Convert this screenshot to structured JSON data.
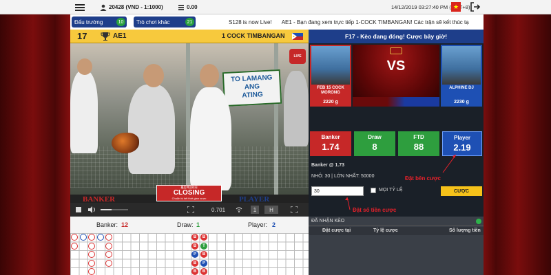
{
  "topbar": {
    "account": "20428 (VND - 1:1000)",
    "balance": "0.00",
    "datetime": "14/12/2019 03:27:40 PM (GMT+8)"
  },
  "tabs": [
    {
      "label": "Đấu trường",
      "count": "10"
    },
    {
      "label": "Trò chơi khác",
      "count": "21"
    }
  ],
  "ticker": [
    "S128 is now Live!",
    "AE1 - Bạn đang xem trực tiếp 1-COCK TIMBANGAN! Các trận sẽ kết thúc tạ"
  ],
  "fight": {
    "number": "17",
    "arena": "AE1",
    "title": "1 COCK TIMBANGAN",
    "status": "F17 - Kèo đang đóng! Cược bây giờ!"
  },
  "video": {
    "sign_text": "TO LAMANG ANG\nATING",
    "banker_label": "BANKER",
    "player_label": "PLAYER",
    "closing_top": "最后押注时间",
    "closing": "CLOSING",
    "closing_sub": "Chuẩn bị hết thời gian cược",
    "time": "0.701",
    "quality": "H"
  },
  "cocks": {
    "left": {
      "name": "FEB 15 COCK MORONG",
      "weight": "2220 g"
    },
    "right": {
      "name": "ALPHINE DJ",
      "weight": "2230 g"
    },
    "vs": "VS"
  },
  "odds": [
    {
      "label": "Banker",
      "value": "1.74",
      "color": "#c62828"
    },
    {
      "label": "Draw",
      "value": "8",
      "color": "#2e9e3e"
    },
    {
      "label": "FTD",
      "value": "88",
      "color": "#2e9e3e"
    },
    {
      "label": "Player",
      "value": "2.19",
      "color": "#1e50b4"
    }
  ],
  "bet": {
    "selection": "Banker @ 1.73",
    "limits": "NHỎ: 30 | LỚN NHẤT: 50000",
    "amount": "30",
    "any_odds": "MỌI TỶ LỆ",
    "submit": "CƯỢC"
  },
  "annotations": {
    "choose_side": "Đặt bên cược",
    "enter_amount": "Đặt số tiền cược"
  },
  "scoreboard": {
    "banker_label": "Banker:",
    "banker": "12",
    "draw_label": "Draw:",
    "draw": "1",
    "player_label": "Player:",
    "player": "2"
  },
  "received": {
    "header": "ĐÃ NHẬN KÈO",
    "col_bet": "Đặt cược tại",
    "col_odds": "Tỷ lệ cược",
    "col_amount": "Số lượng tiền"
  }
}
